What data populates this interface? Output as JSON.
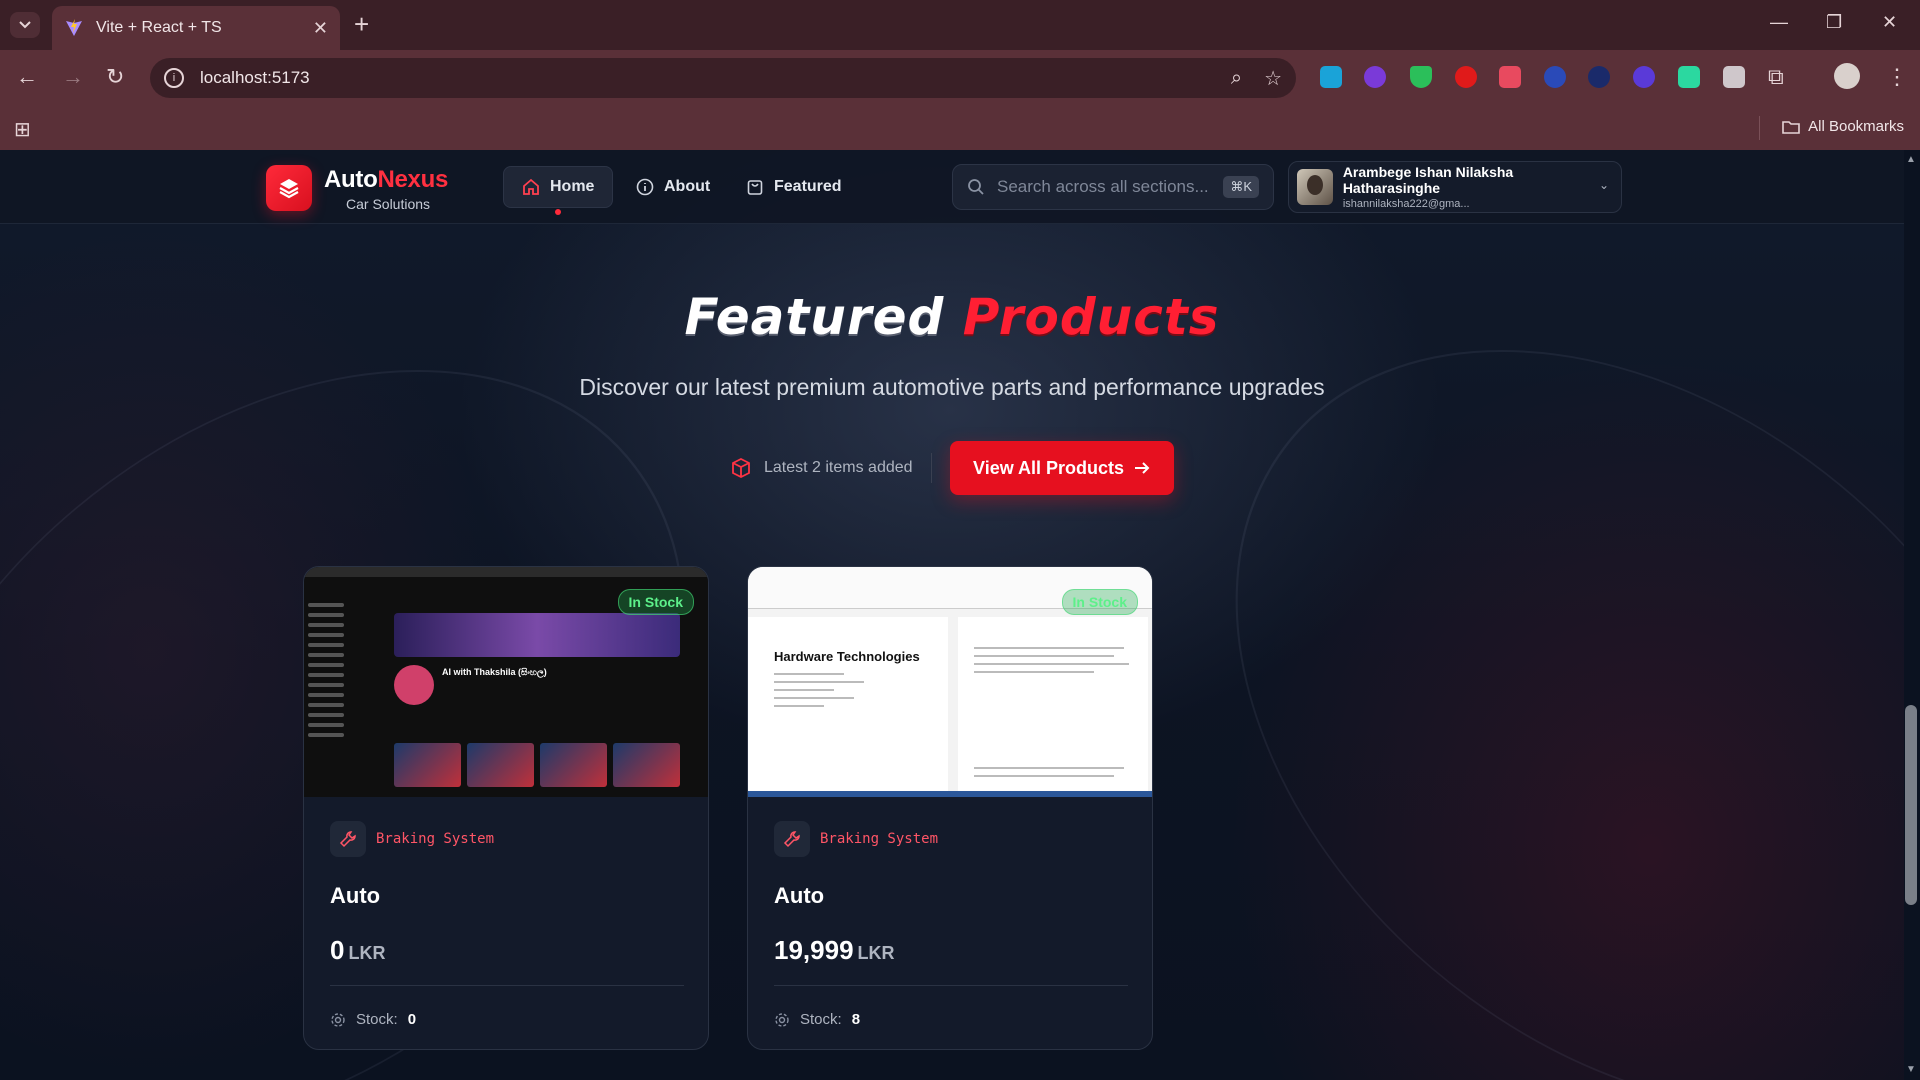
{
  "browser": {
    "tab_title": "Vite + React + TS",
    "url": "localhost:5173",
    "bookmarks_label": "All Bookmarks"
  },
  "site": {
    "brand_part1": "Auto",
    "brand_part2": "Nexus",
    "brand_sub": "Car Solutions",
    "nav": [
      {
        "label": "Home",
        "active": true
      },
      {
        "label": "About",
        "active": false
      },
      {
        "label": "Featured",
        "active": false
      }
    ],
    "search_placeholder": "Search across all sections...",
    "search_shortcut": "⌘K",
    "user": {
      "name": "Arambege Ishan Nilaksha Hatharasinghe",
      "email": "ishannilaksha222@gma..."
    }
  },
  "hero": {
    "title_word1": "Featured",
    "title_word2": "Products",
    "subtitle": "Discover our latest premium automotive parts and performance upgrades",
    "latest_text": "Latest 2 items added",
    "cta_label": "View All Products"
  },
  "products": [
    {
      "badge": "In Stock",
      "category": "Braking System",
      "name": "Auto",
      "price": "0",
      "currency": "LKR",
      "stock_label": "Stock:",
      "stock_value": "0",
      "thumb_channel": "AI with Thakshila (සිංහල)"
    },
    {
      "badge": "In Stock",
      "category": "Braking System",
      "name": "Auto",
      "price": "19,999",
      "currency": "LKR",
      "stock_label": "Stock:",
      "stock_value": "8",
      "thumb_heading": "Hardware Technologies"
    }
  ],
  "colors": {
    "accent": "#e6101f",
    "page_bg": "#0c1220",
    "chrome": "#5a3038",
    "in_stock": "#5df08a"
  }
}
